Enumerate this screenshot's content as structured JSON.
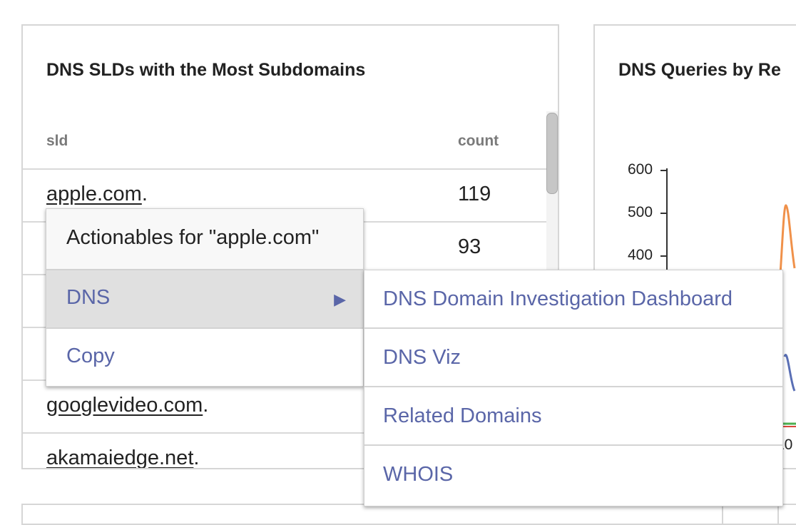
{
  "left_panel": {
    "title": "DNS SLDs with the Most Subdomains",
    "columns": {
      "sld": "sld",
      "count": "count"
    },
    "rows": [
      {
        "sld": "apple.com",
        "suffix": ".",
        "count": "119"
      },
      {
        "sld": "",
        "suffix": "",
        "count": "93"
      },
      {
        "sld": "",
        "suffix": "",
        "count": ""
      },
      {
        "sld": "",
        "suffix": "",
        "count": ""
      },
      {
        "sld": "googlevideo.com",
        "suffix": ".",
        "count": ""
      },
      {
        "sld": "akamaiedge.net",
        "suffix": ".",
        "count": ""
      }
    ]
  },
  "right_panel": {
    "title": "DNS Queries by Re",
    "y_ticks": [
      "600",
      "500",
      "400"
    ],
    "x_tick_partial": "10",
    "series_colors": {
      "orange": "#f0914a",
      "blue": "#5a6fb5",
      "green": "#4caf50",
      "red": "#d9473c"
    }
  },
  "context_menu": {
    "header": "Actionables for \"apple.com\"",
    "items": [
      {
        "label": "DNS",
        "arrow": "▶"
      },
      {
        "label": "Copy"
      }
    ]
  },
  "submenu": {
    "items": [
      {
        "label": "DNS Domain Investigation Dashboard"
      },
      {
        "label": "DNS Viz"
      },
      {
        "label": "Related Domains"
      },
      {
        "label": "WHOIS"
      }
    ]
  }
}
